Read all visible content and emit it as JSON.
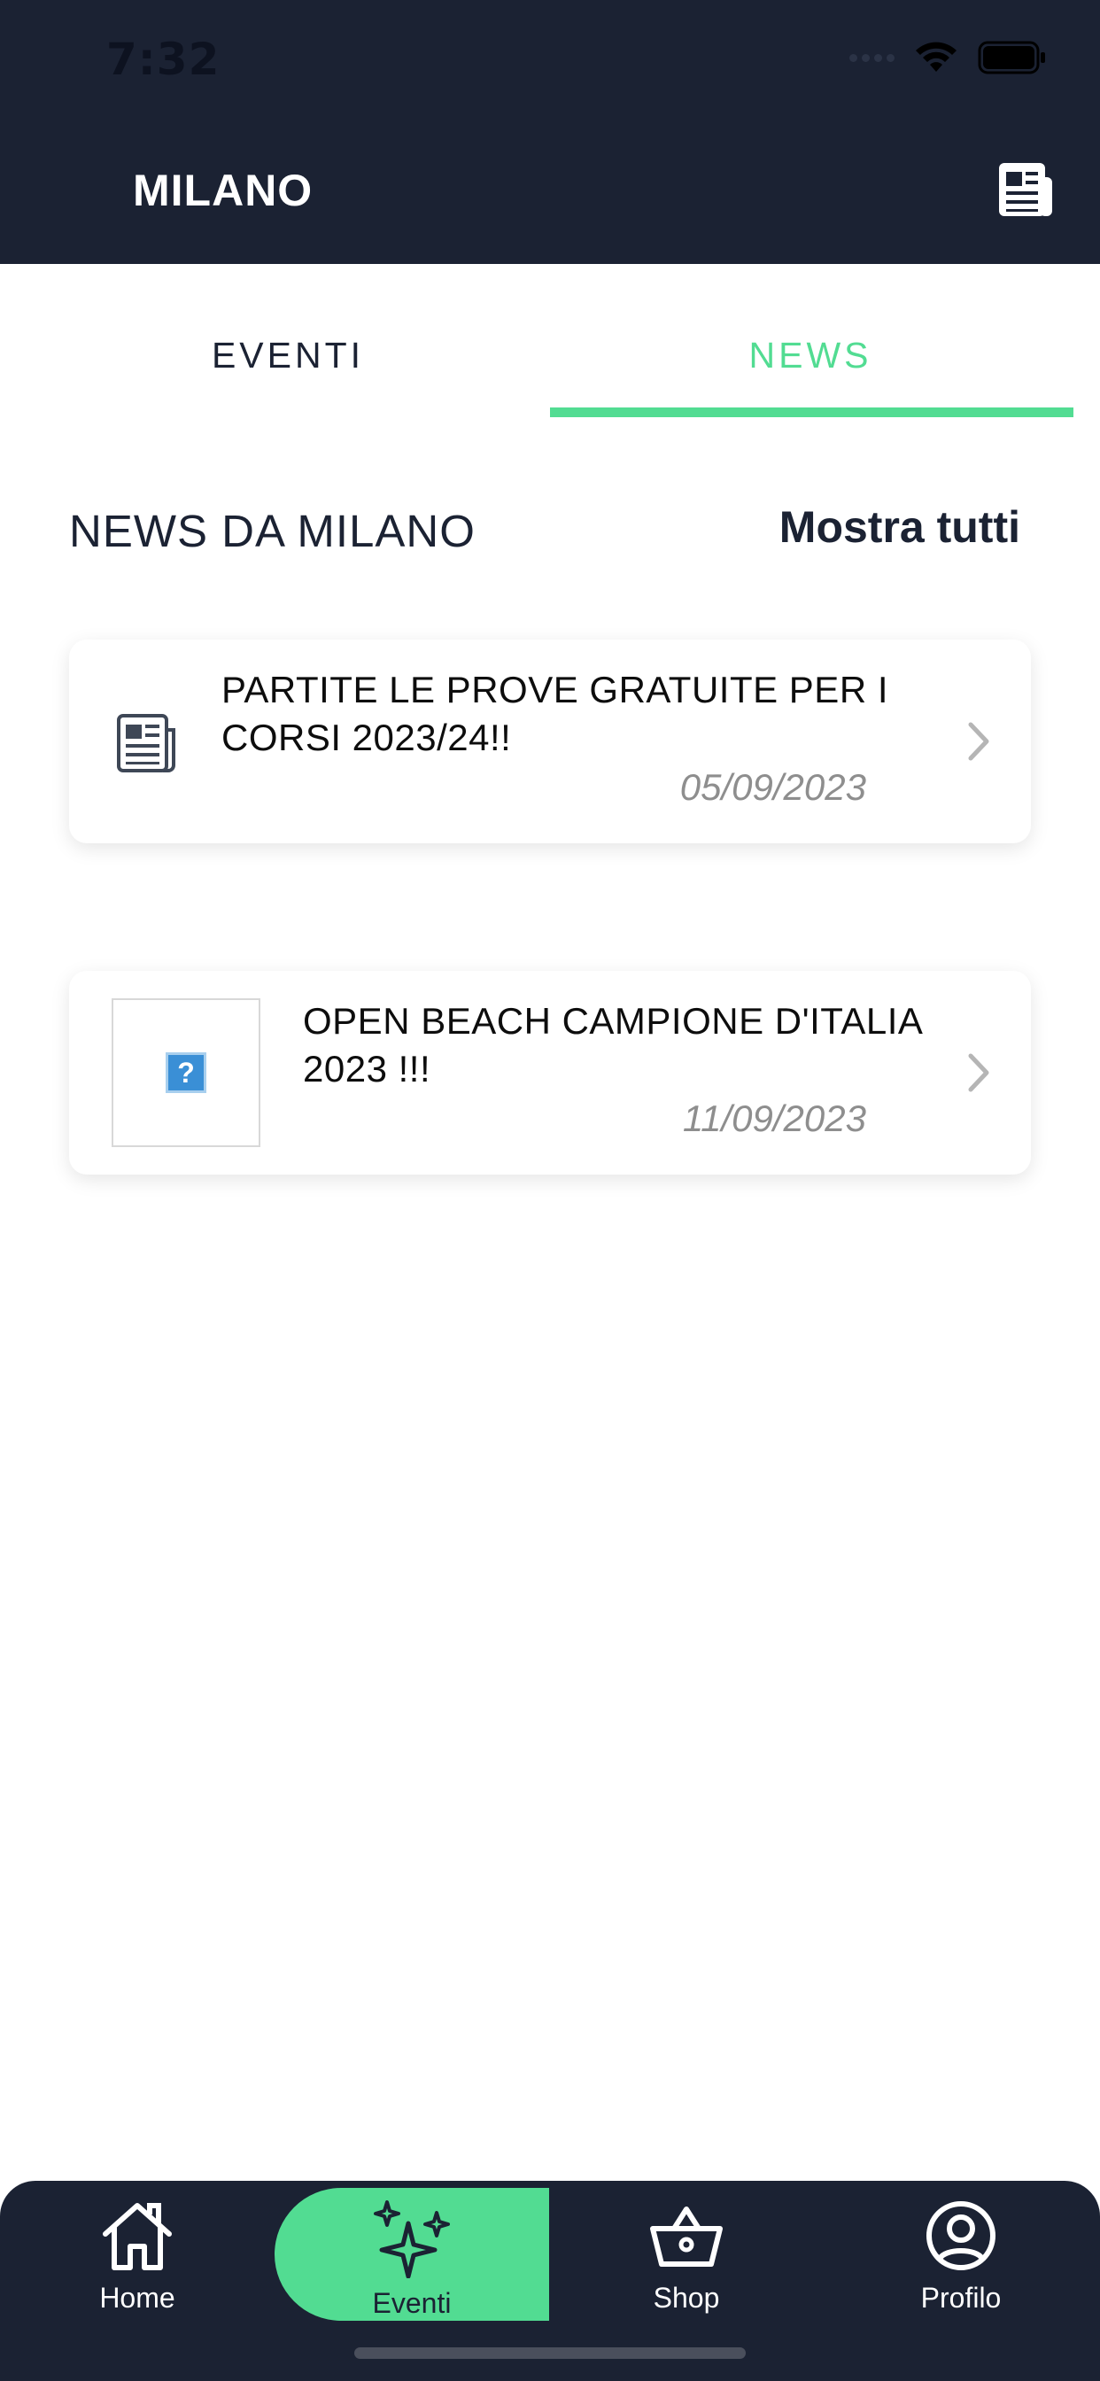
{
  "status_bar": {
    "time": "7:32"
  },
  "header": {
    "title": "MILANO",
    "icon": "newspaper-icon"
  },
  "tabs": [
    {
      "label": "EVENTI",
      "active": false
    },
    {
      "label": "NEWS",
      "active": true
    }
  ],
  "section": {
    "title": "NEWS DA MILANO",
    "show_all": "Mostra tutti"
  },
  "news": [
    {
      "title": "PARTITE LE PROVE GRATUITE PER I CORSI 2023/24!!",
      "date": "05/09/2023",
      "icon": "newspaper-icon"
    },
    {
      "title": "OPEN BEACH CAMPIONE D'ITALIA 2023 !!!",
      "date": "11/09/2023",
      "icon": "missing-image-icon"
    }
  ],
  "bottom_nav": [
    {
      "label": "Home",
      "icon": "home-icon",
      "active": false
    },
    {
      "label": "Eventi",
      "icon": "sparkles-icon",
      "active": true
    },
    {
      "label": "Shop",
      "icon": "basket-icon",
      "active": false
    },
    {
      "label": "Profilo",
      "icon": "profile-icon",
      "active": false
    }
  ],
  "colors": {
    "dark": "#1b2233",
    "accent": "#52dc92",
    "date_grey": "#8e8e8e"
  }
}
